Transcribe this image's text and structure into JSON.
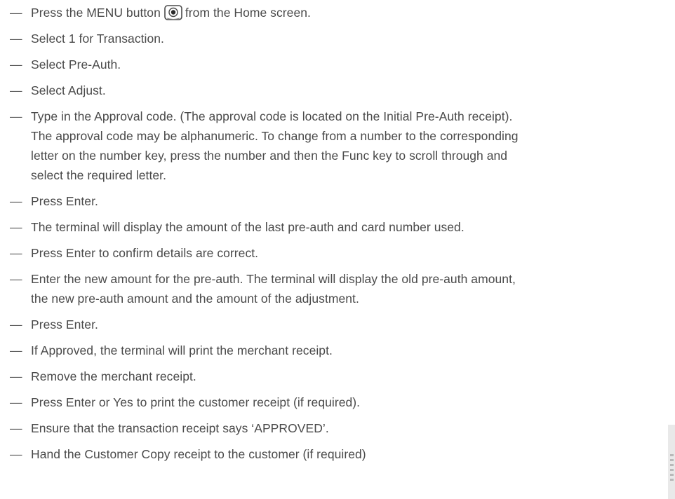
{
  "steps": [
    {
      "before": "Press the MENU button",
      "icon": "menu-button-icon",
      "after": "from the Home screen."
    },
    {
      "text": "Select 1 for Transaction."
    },
    {
      "text": "Select Pre-Auth."
    },
    {
      "text": "Select Adjust."
    },
    {
      "lines": [
        "Type in the Approval code. (The approval code is located on the Initial Pre-Auth receipt).",
        "The approval code may be alphanumeric. To change from a number to the corresponding",
        "letter on the number key, press the number and then the Func key to scroll through and",
        "select the required letter."
      ]
    },
    {
      "text": "Press Enter."
    },
    {
      "text": "The terminal will display the amount of the last pre-auth and card number used."
    },
    {
      "text": "Press Enter to confirm details are correct."
    },
    {
      "lines": [
        "Enter the new amount for the pre-auth. The terminal will display the old pre-auth amount,",
        "the new pre-auth amount and the amount of the adjustment."
      ]
    },
    {
      "text": "Press Enter."
    },
    {
      "text": "If Approved, the terminal will print the merchant receipt."
    },
    {
      "text": "Remove the merchant receipt."
    },
    {
      "text": "Press Enter or Yes to print the customer receipt (if required)."
    },
    {
      "text": "Ensure that the transaction receipt says ‘APPROVED’."
    },
    {
      "text": "Hand the Customer Copy receipt to the customer (if required)"
    }
  ],
  "bullet": "—"
}
